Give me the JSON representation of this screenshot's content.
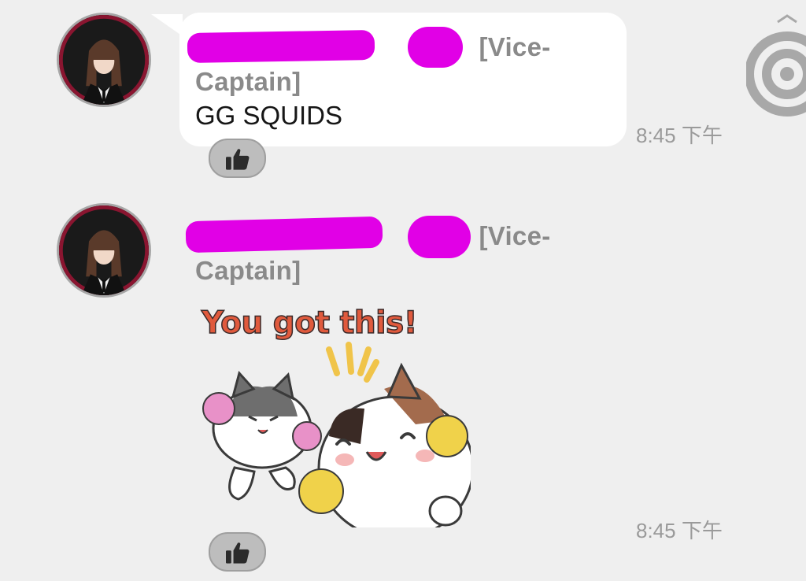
{
  "messages": [
    {
      "sender": "S████████████r [T███] [Vice-Captain]",
      "sender_visible": "[Vice-Captain]",
      "text": "GG SQUIDS",
      "time": "8:45 下午"
    },
    {
      "sender": "S████████████r [T███] [Vice-Captain]",
      "sender_visible": "[Vice-Captain]",
      "sticker_caption": "You got this!",
      "time": "8:45 下午"
    }
  ],
  "icons": {
    "like": "thumbs-up-icon",
    "scroll_target": "target-icon"
  },
  "colors": {
    "background": "#efefef",
    "bubble": "#ffffff",
    "redaction": "#e100e6",
    "sender_text": "#8a8a8a",
    "timestamp": "#9a9a9a"
  }
}
